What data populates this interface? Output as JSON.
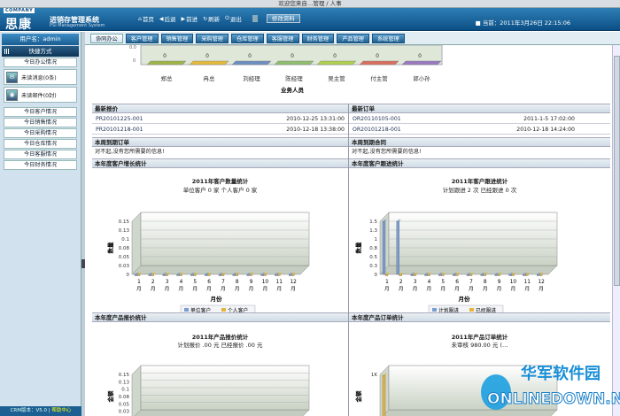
{
  "titlebar": "欢迎您来自…管理 / 人事",
  "logo": {
    "company": "COMPANY",
    "brand": "思康",
    "system": "进销存管理系统",
    "system_en": "PSI Management System"
  },
  "topnav": [
    {
      "label": "首页",
      "icon": "⌂"
    },
    {
      "label": "后退",
      "icon": "◀"
    },
    {
      "label": "前进",
      "icon": "▶"
    },
    {
      "label": "刷新",
      "icon": "↻"
    },
    {
      "label": "退出",
      "icon": "⏻"
    }
  ],
  "edit_profile": "修改资料",
  "datetime": "■ 当前：2011年3月26日  22:15:06",
  "sidebar": {
    "user": "用户名：admin",
    "quick": "快捷方式",
    "today_office": "今日办公情况",
    "unread_msg": "未读消息(0条)",
    "unread_mail": "未读邮件(0封)",
    "items": [
      "今日客户情况",
      "今日销售情况",
      "今日采购情况",
      "今日仓库情况",
      "今日客服情况",
      "今日财务情况"
    ],
    "footer_version": "CRM版本：V5.0 |",
    "footer_help": "帮助中心"
  },
  "tabs": [
    "协同办公",
    "客户管理",
    "销售管理",
    "采购管理",
    "仓库管理",
    "客服管理",
    "财务管理",
    "产品管理",
    "系统管理"
  ],
  "top_chart": {
    "names": [
      "郑总",
      "冉总",
      "刘经理",
      "陈经理",
      "吴主管",
      "付主管",
      "郭小孙"
    ],
    "zero_label": "0",
    "axis_top": "0.0",
    "axis_bottom": "0",
    "xlabel": "业务人员",
    "colors": [
      "#9fb54a",
      "#e4b93c",
      "#6f8fc0",
      "#8fbf6f",
      "#b0d050",
      "#d87060",
      "#9a7ac0"
    ]
  },
  "latest_quote": {
    "title": "最新报价",
    "rows": [
      {
        "code": "PR20101225-001",
        "time": "2010-12-25 13:31:00"
      },
      {
        "code": "PR20101218-001",
        "time": "2010-12-18 13:38:00"
      }
    ]
  },
  "latest_order": {
    "title": "最新订单",
    "rows": [
      {
        "code": "OR20110105-001",
        "time": "2011-1-5 17:02:00"
      },
      {
        "code": "OR20101218-001",
        "time": "2010-12-18 14:24:00"
      }
    ]
  },
  "week_due_orders": {
    "title": "本周到期订单",
    "note": "对不起,没有您所需要的信息!"
  },
  "week_due_contracts": {
    "title": "本周到期合同",
    "note": "对不起,没有您所需要的信息!"
  },
  "cust_growth": {
    "section": "本年度客户增长统计",
    "title": "2011年客户数量统计",
    "subtitle": "单位客户 0 家 个人客户 0 家"
  },
  "cust_follow": {
    "section": "本年度客户跟进统计",
    "title": "2011年客户跟进统计",
    "subtitle": "计划跟进 2 次 已经跟进 0 次"
  },
  "prod_quote": {
    "section": "本年度产品报价统计",
    "title": "2011年产品报价统计",
    "subtitle": "计划报价 .00 元 已经报价 .00 元"
  },
  "prod_order": {
    "section": "本年度产品订单统计",
    "title": "2011年产品订单统计",
    "subtitle": "未审核 980.00 元 (…"
  },
  "chart_data": [
    {
      "type": "bar",
      "title": "2011年客户数量统计",
      "subtitle": "单位客户 0 家 个人客户 0 家",
      "categories": [
        "1月",
        "2月",
        "3月",
        "4月",
        "5月",
        "6月",
        "7月",
        "8月",
        "9月",
        "10月",
        "11月",
        "12月"
      ],
      "xlabel": "月份",
      "ylabel": "数量",
      "yticks": [
        "0",
        "0.03",
        "0.05",
        "0.08",
        "0.1",
        "0.13",
        "0.15"
      ],
      "ylim": [
        0,
        0.15
      ],
      "series": [
        {
          "name": "单位客户",
          "color": "#7a9cd0",
          "values": [
            0,
            0,
            0,
            0,
            0,
            0,
            0,
            0,
            0,
            0,
            0,
            0
          ]
        },
        {
          "name": "个人客户",
          "color": "#e5b53a",
          "values": [
            0,
            0,
            0,
            0,
            0,
            0,
            0,
            0,
            0,
            0,
            0,
            0
          ]
        }
      ]
    },
    {
      "type": "bar",
      "title": "2011年客户跟进统计",
      "subtitle": "计划跟进 2 次 已经跟进 0 次",
      "categories": [
        "1月",
        "2月",
        "3月",
        "4月",
        "5月",
        "6月",
        "7月",
        "8月",
        "9月",
        "10月",
        "11月",
        "12月"
      ],
      "xlabel": "月份",
      "ylabel": "数量",
      "yticks": [
        "0",
        "0.3",
        "0.5",
        "0.8",
        "1",
        "1.3",
        "1.5"
      ],
      "ylim": [
        0,
        1.5
      ],
      "series": [
        {
          "name": "计划跟进",
          "color": "#7a9cd0",
          "values": [
            1.5,
            1.5,
            0,
            0,
            0,
            0,
            0,
            0,
            0,
            0,
            0,
            0
          ]
        },
        {
          "name": "已经跟进",
          "color": "#e5b53a",
          "values": [
            0,
            0,
            0,
            0,
            0,
            0,
            0,
            0,
            0,
            0,
            0,
            0
          ]
        }
      ]
    },
    {
      "type": "bar",
      "title": "2011年产品报价统计",
      "subtitle": "计划报价 .00 元 已经报价 .00 元",
      "categories": [],
      "ylabel": "金额",
      "yticks": [
        "0",
        "0.03",
        "0.05",
        "0.08",
        "0.1",
        "0.13",
        "0.15"
      ],
      "ylim": [
        0,
        0.15
      ],
      "series": []
    },
    {
      "type": "bar",
      "title": "2011年产品订单统计",
      "subtitle": "未审核 980.00 元 (…",
      "categories": [],
      "ylabel": "金额",
      "yticks": [
        "800",
        "1K"
      ],
      "ylim": [
        0,
        1000
      ],
      "series": [
        {
          "name": "",
          "color": "#e5b53a",
          "values": [
            980
          ]
        }
      ]
    }
  ]
}
